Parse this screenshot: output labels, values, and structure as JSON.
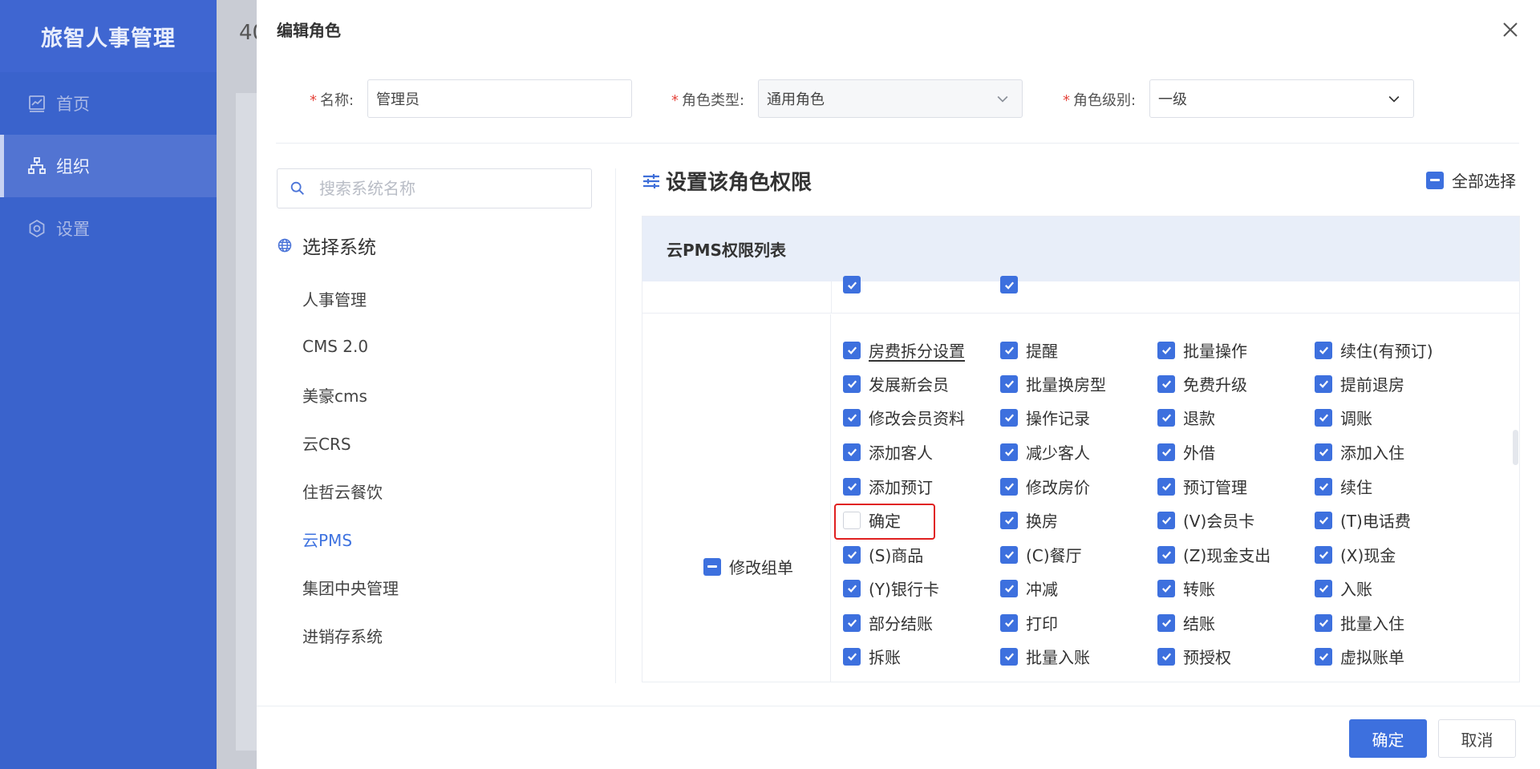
{
  "app": {
    "brand": "旅智人事管理",
    "nav": [
      {
        "label": "首页",
        "icon": "chart-icon"
      },
      {
        "label": "组织",
        "icon": "org-tree-icon"
      },
      {
        "label": "设置",
        "icon": "gear-icon"
      }
    ],
    "background_heading": "40"
  },
  "drawer": {
    "title": "编辑角色",
    "form": {
      "name_label": "名称:",
      "name_value": "管理员",
      "type_label": "角色类型:",
      "type_value": "通用角色",
      "level_label": "角色级别:",
      "level_value": "一级",
      "required_mark": "*"
    },
    "systems": {
      "search_placeholder": "搜索系统名称",
      "header": "选择系统",
      "items": [
        "人事管理",
        "CMS 2.0",
        "美豪cms",
        "云CRS",
        "住哲云餐饮",
        "云PMS",
        "集团中央管理",
        "进销存系统"
      ],
      "active": "云PMS"
    },
    "permissions": {
      "title": "设置该角色权限",
      "select_all": "全部选择",
      "list_title": "云PMS权限列表",
      "group_label": "修改组单",
      "rows": [
        [
          "房费拆分设置",
          "提醒",
          "批量操作",
          "续住(有预订)"
        ],
        [
          "发展新会员",
          "批量换房型",
          "免费升级",
          "提前退房"
        ],
        [
          "修改会员资料",
          "操作记录",
          "退款",
          "调账"
        ],
        [
          "添加客人",
          "减少客人",
          "外借",
          "添加入住"
        ],
        [
          "添加预订",
          "修改房价",
          "预订管理",
          "续住"
        ],
        [
          "确定",
          "换房",
          "(V)会员卡",
          "(T)电话费"
        ],
        [
          "(S)商品",
          "(C)餐厅",
          "(Z)现金支出",
          "(X)现金"
        ],
        [
          "(Y)银行卡",
          "冲减",
          "转账",
          "入账"
        ],
        [
          "部分结账",
          "打印",
          "结账",
          "批量入住"
        ],
        [
          "拆账",
          "批量入账",
          "预授权",
          "虚拟账单"
        ]
      ],
      "unchecked": [
        "确定"
      ]
    },
    "footer": {
      "confirm": "确定",
      "cancel": "取消"
    }
  }
}
